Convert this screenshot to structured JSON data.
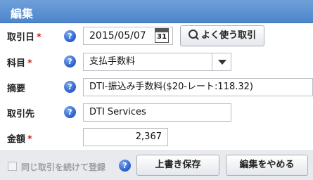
{
  "dialog": {
    "title": "編集"
  },
  "fields": {
    "date": {
      "label": "取引日",
      "required_mark": "*",
      "value": "2015/05/07",
      "calendar_day": "31"
    },
    "favorites_button": "よく使う取引",
    "account": {
      "label": "科目",
      "required_mark": "*",
      "value": "支払手数料"
    },
    "summary": {
      "label": "摘要",
      "value": "DTI-振込み手数料($20-レート:118.32)"
    },
    "partner": {
      "label": "取引先",
      "value": "DTI Services"
    },
    "amount": {
      "label": "金額",
      "required_mark": "*",
      "value": "2,367"
    }
  },
  "help_glyph": "?",
  "footer": {
    "continue_checkbox_label": "同じ取引を続けて登録",
    "save_button": "上書き保存",
    "cancel_button": "編集をやめる"
  },
  "colors": {
    "titlebar": "#5a8fd1",
    "required": "#d02020",
    "help_icon": "#2a5dc9"
  },
  "icons": {
    "help": "question-circle-icon",
    "calendar": "calendar-icon",
    "search": "magnifier-icon",
    "dropdown": "chevron-down-icon"
  }
}
